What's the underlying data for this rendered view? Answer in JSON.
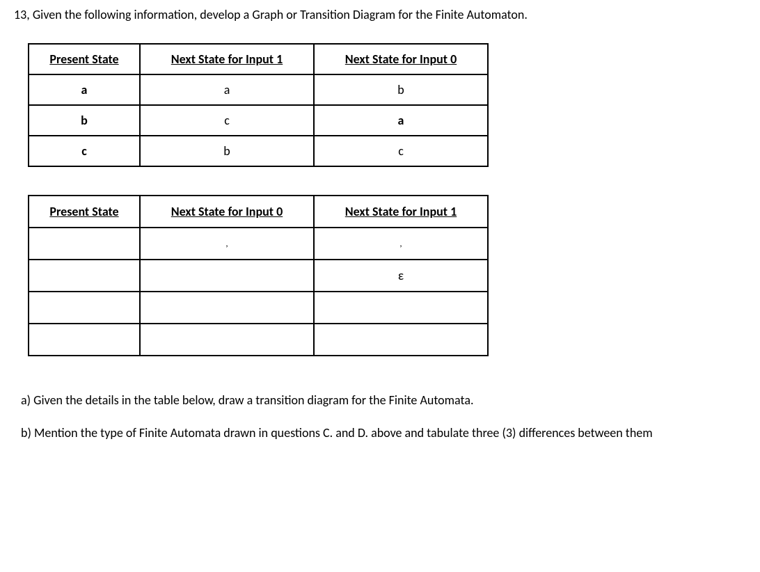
{
  "question_number": "13,",
  "question_text": "Given the following information, develop a Graph or Transition Diagram for the Finite Automaton.",
  "table1": {
    "headers": [
      "Present State",
      "Next State for Input 1",
      "Next State for Input 0"
    ],
    "rows": [
      {
        "c1": "a",
        "c2": "a",
        "c3": "b"
      },
      {
        "c1": "b",
        "c2": "c",
        "c3": "a"
      },
      {
        "c1": "c",
        "c2": "b",
        "c3": "c"
      }
    ]
  },
  "table2": {
    "headers": [
      "Present State",
      "Next State for Input 0",
      "Next State for Input 1"
    ],
    "rows": [
      {
        "c1": "",
        "c2": ",",
        "c3": ","
      },
      {
        "c1": "",
        "c2": "",
        "c3": "ε"
      },
      {
        "c1": "",
        "c2": "",
        "c3": ""
      },
      {
        "c1": "",
        "c2": "",
        "c3": ""
      }
    ]
  },
  "sub_a": "a) Given the details in the table below, draw a transition diagram for the Finite Automata.",
  "sub_b_prefix": "b) ",
  "sub_b_text": "Mention the type of Finite Automata drawn in questions C. and D. above and tabulate three (3) differences between them"
}
